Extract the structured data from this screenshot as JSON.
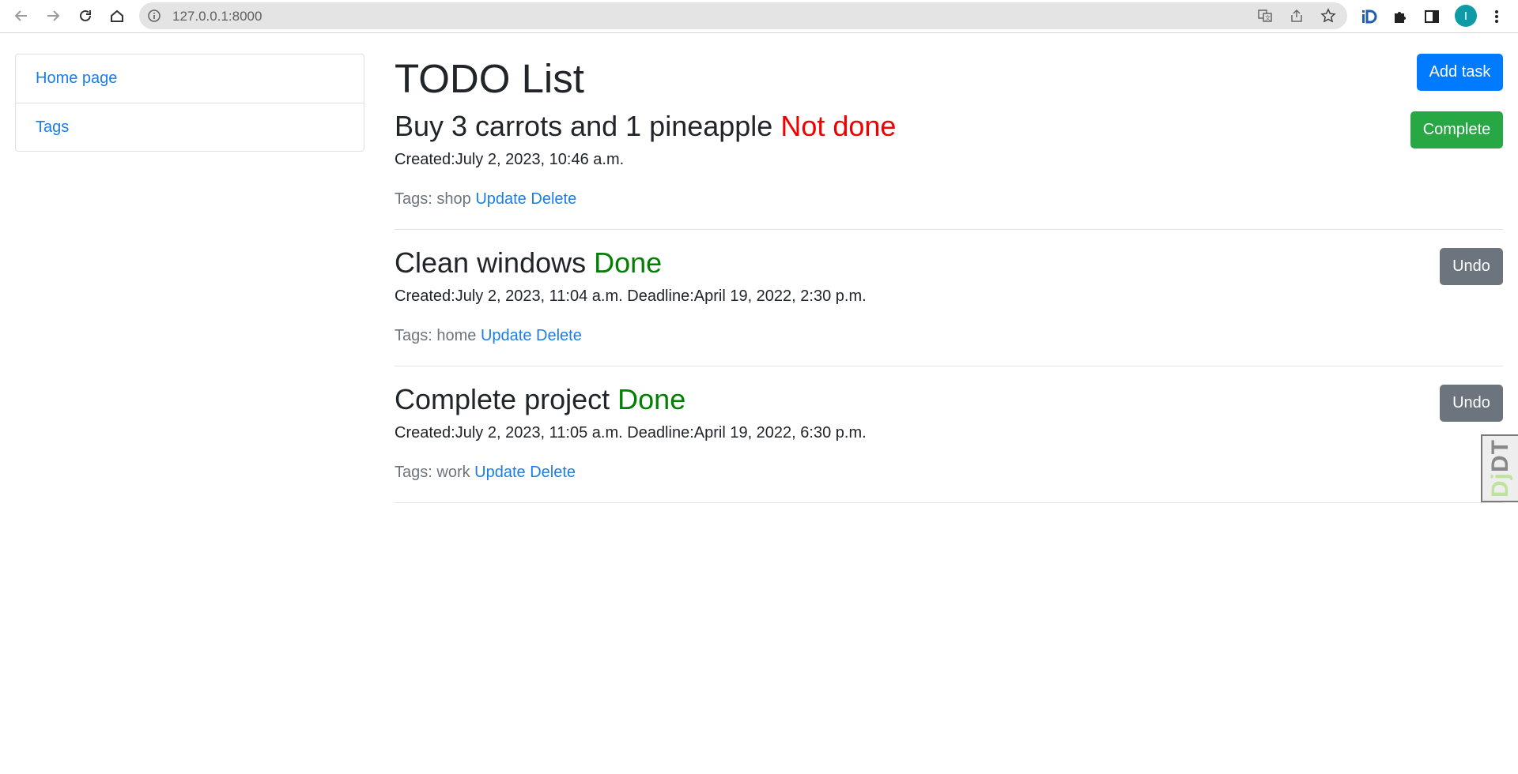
{
  "browser": {
    "url": "127.0.0.1:8000",
    "avatar_letter": "I"
  },
  "sidebar": {
    "items": [
      {
        "label": "Home page"
      },
      {
        "label": "Tags"
      }
    ]
  },
  "main": {
    "title": "TODO List",
    "add_task_label": "Add task",
    "tasks": [
      {
        "title": "Buy 3 carrots and 1 pineapple",
        "status": "Not done",
        "meta": "Created:July 2, 2023, 10:46 a.m.",
        "tags_label": "Tags:",
        "tag": "shop",
        "update_label": "Update",
        "delete_label": "Delete",
        "action_label": "Complete"
      },
      {
        "title": "Clean windows",
        "status": "Done",
        "meta": "Created:July 2, 2023, 11:04 a.m. Deadline:April 19, 2022, 2:30 p.m.",
        "tags_label": "Tags:",
        "tag": "home",
        "update_label": "Update",
        "delete_label": "Delete",
        "action_label": "Undo"
      },
      {
        "title": "Complete project",
        "status": "Done",
        "meta": "Created:July 2, 2023, 11:05 a.m. Deadline:April 19, 2022, 6:30 p.m.",
        "tags_label": "Tags:",
        "tag": "work",
        "update_label": "Update",
        "delete_label": "Delete",
        "action_label": "Undo"
      }
    ]
  },
  "djdt": {
    "prefix": "Dj",
    "suffix": "DT"
  },
  "colors": {
    "primary": "#007bff",
    "success": "#28a745",
    "secondary": "#6c757d",
    "status_not_done": "#f20000",
    "status_done": "#008000",
    "link": "#1a7ee6"
  }
}
